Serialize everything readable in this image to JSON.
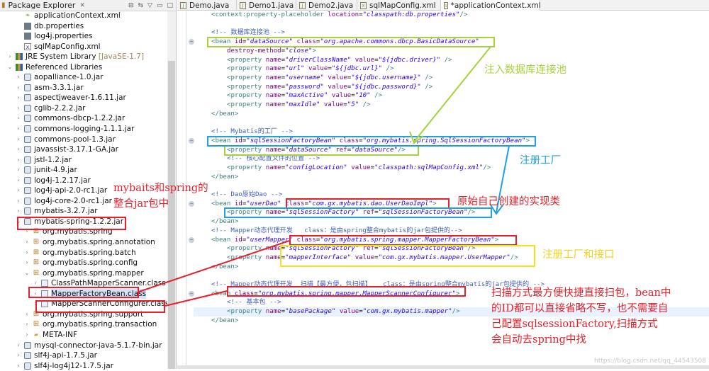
{
  "package_explorer": {
    "title": "Package Explorer",
    "items": [
      {
        "level": 3,
        "icon": "spr",
        "label": "applicationContext.xml",
        "expander": ""
      },
      {
        "level": 3,
        "icon": "prop",
        "label": "db.properties",
        "expander": ""
      },
      {
        "level": 3,
        "icon": "prop",
        "label": "log4j.properties",
        "expander": ""
      },
      {
        "level": 3,
        "icon": "xml",
        "label": "sqlMapConfig.xml",
        "expander": ""
      },
      {
        "level": 2,
        "icon": "lib",
        "label": "JRE System Library",
        "decor": " [JavaSE-1.7]",
        "expander": "›"
      },
      {
        "level": 2,
        "icon": "lib",
        "label": "Referenced Libraries",
        "expander": "⌄"
      },
      {
        "level": 3,
        "icon": "jar",
        "label": "aopalliance-1.0.jar",
        "expander": "›"
      },
      {
        "level": 3,
        "icon": "jar",
        "label": "asm-3.3.1.jar",
        "expander": "›"
      },
      {
        "level": 3,
        "icon": "jar",
        "label": "aspectjweaver-1.6.11.jar",
        "expander": "›"
      },
      {
        "level": 3,
        "icon": "jar",
        "label": "cglib-2.2.2.jar",
        "expander": "›"
      },
      {
        "level": 3,
        "icon": "jar",
        "label": "commons-dbcp-1.2.2.jar",
        "expander": "›"
      },
      {
        "level": 3,
        "icon": "jar",
        "label": "commons-logging-1.1.1.jar",
        "expander": "›"
      },
      {
        "level": 3,
        "icon": "jar",
        "label": "commons-pool-1.3.jar",
        "expander": "›"
      },
      {
        "level": 3,
        "icon": "jar",
        "label": "javassist-3.17.1-GA.jar",
        "expander": "›"
      },
      {
        "level": 3,
        "icon": "jar",
        "label": "jstl-1.2.jar",
        "expander": "›"
      },
      {
        "level": 3,
        "icon": "jar",
        "label": "junit-4.9.jar",
        "expander": "›"
      },
      {
        "level": 3,
        "icon": "jar",
        "label": "log4j-1.2.17.jar",
        "expander": "›"
      },
      {
        "level": 3,
        "icon": "jar",
        "label": "log4j-api-2.0-rc1.jar",
        "expander": "›"
      },
      {
        "level": 3,
        "icon": "jar",
        "label": "log4j-core-2.0-rc1.jar",
        "expander": "›"
      },
      {
        "level": 3,
        "icon": "jar",
        "label": "mybatis-3.2.7.jar",
        "expander": "›"
      },
      {
        "level": 3,
        "icon": "jar",
        "label": "mybatis-spring-1.2.2.jar",
        "expander": "⌄"
      },
      {
        "level": 4,
        "icon": "pkg",
        "label": "org.mybatis.spring",
        "expander": "›"
      },
      {
        "level": 4,
        "icon": "pkg",
        "label": "org.mybatis.spring.annotation",
        "expander": "›"
      },
      {
        "level": 4,
        "icon": "pkg",
        "label": "org.mybatis.spring.batch",
        "expander": "›"
      },
      {
        "level": 4,
        "icon": "pkg",
        "label": "org.mybatis.spring.config",
        "expander": "›"
      },
      {
        "level": 4,
        "icon": "pkg",
        "label": "org.mybatis.spring.mapper",
        "expander": "⌄"
      },
      {
        "level": 5,
        "icon": "cls",
        "label": "ClassPathMapperScanner.class",
        "expander": "›"
      },
      {
        "level": 5,
        "icon": "cls",
        "label": "MapperFactoryBean.class",
        "expander": "›",
        "selected": true
      },
      {
        "level": 5,
        "icon": "cls",
        "label": "MapperScannerConfigurer.class",
        "expander": "›"
      },
      {
        "level": 4,
        "icon": "pkg",
        "label": "org.mybatis.spring.support",
        "expander": "›"
      },
      {
        "level": 4,
        "icon": "pkg",
        "label": "org.mybatis.spring.transaction",
        "expander": "›"
      },
      {
        "level": 4,
        "icon": "fold",
        "label": "META-INF",
        "expander": "›"
      },
      {
        "level": 3,
        "icon": "jar",
        "label": "mysql-connector-java-5.1.7-bin.jar",
        "expander": "›"
      },
      {
        "level": 3,
        "icon": "jar",
        "label": "slf4j-api-1.7.5.jar",
        "expander": "›"
      },
      {
        "level": 3,
        "icon": "jar",
        "label": "slf4j-log4j12-1.7.5.jar",
        "expander": "›"
      }
    ]
  },
  "editor_tabs": [
    {
      "label": "Demo.java",
      "icon": "J"
    },
    {
      "label": "Demo1.java",
      "icon": "J"
    },
    {
      "label": "Demo2.java",
      "icon": "J"
    },
    {
      "label": "sqlMapConfig.xml",
      "icon": "x"
    },
    {
      "label": "*applicationContext.xml",
      "icon": "s",
      "active": true
    }
  ],
  "code_lines": [
    {
      "indent": 1,
      "segs": [
        [
          "t",
          "<context:property-placeholder "
        ],
        [
          "a",
          "location"
        ],
        [
          "p",
          "="
        ],
        [
          "v",
          "\"classpath:db.properties\""
        ],
        [
          "t",
          "/>"
        ]
      ]
    },
    {
      "indent": 0,
      "segs": []
    },
    {
      "indent": 1,
      "segs": [
        [
          "c",
          "<!-- 数据库连接池 -->"
        ]
      ]
    },
    {
      "indent": 1,
      "fold": true,
      "segs": [
        [
          "t",
          "<bean "
        ],
        [
          "a",
          "id"
        ],
        [
          "p",
          "="
        ],
        [
          "v",
          "\"dataSource\""
        ],
        [
          "p",
          " "
        ],
        [
          "a",
          "class"
        ],
        [
          "p",
          "="
        ],
        [
          "v",
          "\"org.apache.commons.dbcp.BasicDataSource\""
        ]
      ]
    },
    {
      "indent": 2,
      "segs": [
        [
          "a",
          "destroy-method"
        ],
        [
          "p",
          "="
        ],
        [
          "v",
          "\"close\""
        ],
        [
          "t",
          ">"
        ]
      ]
    },
    {
      "indent": 2,
      "segs": [
        [
          "t",
          "<property "
        ],
        [
          "a",
          "name"
        ],
        [
          "p",
          "="
        ],
        [
          "v",
          "\"driverClassName\""
        ],
        [
          "p",
          " "
        ],
        [
          "a",
          "value"
        ],
        [
          "p",
          "="
        ],
        [
          "v",
          "\"${jdbc.driver}\""
        ],
        [
          "t",
          " />"
        ]
      ]
    },
    {
      "indent": 2,
      "segs": [
        [
          "t",
          "<property "
        ],
        [
          "a",
          "name"
        ],
        [
          "p",
          "="
        ],
        [
          "v",
          "\"url\""
        ],
        [
          "p",
          " "
        ],
        [
          "a",
          "value"
        ],
        [
          "p",
          "="
        ],
        [
          "v",
          "\"${jdbc.url}\""
        ],
        [
          "t",
          " />"
        ]
      ]
    },
    {
      "indent": 2,
      "segs": [
        [
          "t",
          "<property "
        ],
        [
          "a",
          "name"
        ],
        [
          "p",
          "="
        ],
        [
          "v",
          "\"username\""
        ],
        [
          "p",
          " "
        ],
        [
          "a",
          "value"
        ],
        [
          "p",
          "="
        ],
        [
          "v",
          "\"${jdbc.username}\""
        ],
        [
          "t",
          " />"
        ]
      ]
    },
    {
      "indent": 2,
      "segs": [
        [
          "t",
          "<property "
        ],
        [
          "a",
          "name"
        ],
        [
          "p",
          "="
        ],
        [
          "v",
          "\"password\""
        ],
        [
          "p",
          " "
        ],
        [
          "a",
          "value"
        ],
        [
          "p",
          "="
        ],
        [
          "v",
          "\"${jdbc.password}\""
        ],
        [
          "t",
          " />"
        ]
      ]
    },
    {
      "indent": 2,
      "segs": [
        [
          "t",
          "<property "
        ],
        [
          "a",
          "name"
        ],
        [
          "p",
          "="
        ],
        [
          "v",
          "\"maxActive\""
        ],
        [
          "p",
          " "
        ],
        [
          "a",
          "value"
        ],
        [
          "p",
          "="
        ],
        [
          "v",
          "\"10\""
        ],
        [
          "t",
          " />"
        ]
      ]
    },
    {
      "indent": 2,
      "segs": [
        [
          "t",
          "<property "
        ],
        [
          "a",
          "name"
        ],
        [
          "p",
          "="
        ],
        [
          "v",
          "\"maxIdle\""
        ],
        [
          "p",
          " "
        ],
        [
          "a",
          "value"
        ],
        [
          "p",
          "="
        ],
        [
          "v",
          "\"5\""
        ],
        [
          "t",
          " />"
        ]
      ]
    },
    {
      "indent": 1,
      "segs": [
        [
          "t",
          "</bean>"
        ]
      ]
    },
    {
      "indent": 0,
      "segs": []
    },
    {
      "indent": 1,
      "segs": [
        [
          "c",
          "<!-- Mybatis的工厂 -->"
        ]
      ]
    },
    {
      "indent": 1,
      "fold": true,
      "segs": [
        [
          "t",
          "<bean "
        ],
        [
          "a",
          "id"
        ],
        [
          "p",
          "="
        ],
        [
          "v",
          "\"sqlSessionFactoryBean\""
        ],
        [
          "p",
          " "
        ],
        [
          "a",
          "class"
        ],
        [
          "p",
          "="
        ],
        [
          "v",
          "\"org.mybatis.spring.SqlSessionFactoryBean\""
        ],
        [
          "t",
          ">"
        ]
      ]
    },
    {
      "indent": 2,
      "segs": [
        [
          "t",
          "<property "
        ],
        [
          "a",
          "name"
        ],
        [
          "p",
          "="
        ],
        [
          "v",
          "\"dataSource\""
        ],
        [
          "p",
          " "
        ],
        [
          "a",
          "ref"
        ],
        [
          "p",
          "="
        ],
        [
          "v",
          "\"dataSource\""
        ],
        [
          "t",
          "/>"
        ]
      ]
    },
    {
      "indent": 2,
      "segs": [
        [
          "c",
          "<!-- 核心配置文件的位置 -->"
        ]
      ]
    },
    {
      "indent": 2,
      "segs": [
        [
          "t",
          "<property "
        ],
        [
          "a",
          "name"
        ],
        [
          "p",
          "="
        ],
        [
          "v",
          "\"configLocation\""
        ],
        [
          "p",
          " "
        ],
        [
          "a",
          "value"
        ],
        [
          "p",
          "="
        ],
        [
          "v",
          "\"classpath:sqlMapConfig.xml\""
        ],
        [
          "t",
          "/>"
        ]
      ]
    },
    {
      "indent": 1,
      "segs": [
        [
          "t",
          "</bean>"
        ]
      ]
    },
    {
      "indent": 0,
      "segs": []
    },
    {
      "indent": 1,
      "segs": [
        [
          "c",
          "<!-- Dao原始Dao -->"
        ]
      ]
    },
    {
      "indent": 1,
      "fold": true,
      "segs": [
        [
          "t",
          "<bean "
        ],
        [
          "a",
          "id"
        ],
        [
          "p",
          "="
        ],
        [
          "v",
          "\"userDao\""
        ],
        [
          "p",
          " "
        ],
        [
          "a",
          "class"
        ],
        [
          "p",
          "="
        ],
        [
          "v",
          "\"com.gx.mybatis.dao.UserDaoImpl\""
        ],
        [
          "t",
          ">"
        ]
      ]
    },
    {
      "indent": 2,
      "segs": [
        [
          "t",
          "<property "
        ],
        [
          "a",
          "name"
        ],
        [
          "p",
          "="
        ],
        [
          "v",
          "\"sqlSessionFactory\""
        ],
        [
          "p",
          " "
        ],
        [
          "a",
          "ref"
        ],
        [
          "p",
          "="
        ],
        [
          "v",
          "\"sqlSessionFactoryBean\""
        ],
        [
          "t",
          "/>"
        ]
      ]
    },
    {
      "indent": 1,
      "segs": [
        [
          "t",
          "</bean>"
        ]
      ]
    },
    {
      "indent": 1,
      "segs": [
        [
          "c",
          "<!-- Mapper动态代理开发   class：是由spring整合mybatis的jar包提供的-->"
        ]
      ]
    },
    {
      "indent": 1,
      "fold": true,
      "segs": [
        [
          "t",
          "<bean "
        ],
        [
          "a",
          "id"
        ],
        [
          "p",
          "="
        ],
        [
          "v",
          "\"userMapper\""
        ],
        [
          "p",
          " "
        ],
        [
          "a",
          "class"
        ],
        [
          "p",
          "="
        ],
        [
          "v",
          "\"org.mybatis.spring.mapper.MapperFactoryBean\""
        ],
        [
          "t",
          ">"
        ]
      ]
    },
    {
      "indent": 2,
      "segs": [
        [
          "t",
          "<property "
        ],
        [
          "a",
          "name"
        ],
        [
          "p",
          "="
        ],
        [
          "v",
          "\"sqlSessionFactory\""
        ],
        [
          "p",
          " "
        ],
        [
          "a",
          "ref"
        ],
        [
          "p",
          "="
        ],
        [
          "v",
          "\"sqlSessionFactoryBean\""
        ],
        [
          "t",
          "/>"
        ]
      ]
    },
    {
      "indent": 2,
      "segs": [
        [
          "t",
          "<property "
        ],
        [
          "a",
          "name"
        ],
        [
          "p",
          "="
        ],
        [
          "v",
          "\"mapperInterface\""
        ],
        [
          "p",
          " "
        ],
        [
          "a",
          "value"
        ],
        [
          "p",
          "="
        ],
        [
          "v",
          "\"com.gx.mybatis.mapper.UserMapper\""
        ],
        [
          "t",
          "/>"
        ]
      ]
    },
    {
      "indent": 1,
      "segs": [
        [
          "t",
          "</bean>"
        ]
      ]
    },
    {
      "indent": 0,
      "segs": []
    },
    {
      "indent": 1,
      "segs": [
        [
          "c",
          "<!-- Mapper动态代理开发  扫描【最方便，包扫描】   class：是由spring整合mybatis的jar包提供的 -->"
        ]
      ]
    },
    {
      "indent": 1,
      "fold": true,
      "segs": [
        [
          "t",
          "<bean "
        ],
        [
          "a",
          "class"
        ],
        [
          "p",
          "="
        ],
        [
          "v",
          "\"org.mybatis.spring.mapper.MapperScannerConfigurer\""
        ],
        [
          "t",
          ">"
        ]
      ]
    },
    {
      "indent": 2,
      "segs": [
        [
          "c",
          "<!-- 基本包 -->"
        ]
      ]
    },
    {
      "indent": 2,
      "current": true,
      "segs": [
        [
          "t",
          "<property "
        ],
        [
          "a",
          "name"
        ],
        [
          "p",
          "="
        ],
        [
          "v",
          "\"basePackage\""
        ],
        [
          "p",
          " "
        ],
        [
          "a",
          "value"
        ],
        [
          "p",
          "="
        ],
        [
          "v",
          "\"com.gx.mybatis.mapper\""
        ],
        [
          "t",
          "/>"
        ]
      ]
    },
    {
      "indent": 1,
      "segs": [
        [
          "t",
          "</bean>"
        ]
      ]
    }
  ],
  "annotations": {
    "inject_datasource": "注入数据库连接池",
    "register_factory": "注册工厂",
    "original_impl": "原始自己创建的实现类",
    "register_factory_interface": "注册工厂和接口",
    "jar_note": "mybaits和spring的\n整合jar包中",
    "scan_note": "扫描方式最方便快捷直接扫包，bean中\n的ID都可以直接省略不写，也不需要自\n己配置sqlsessionFactory,扫描方式\n会自动去spring中找"
  },
  "watermark": "https://blog.csdn.net/qq_44543508",
  "colors": {
    "green": "#a6d33a",
    "blue": "#1fa0e0",
    "red": "#e8202a",
    "yellow": "#f2e21a"
  }
}
